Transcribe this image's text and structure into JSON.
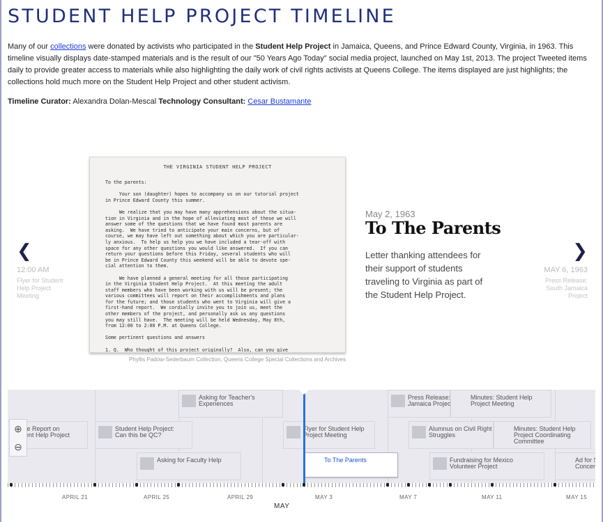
{
  "page": {
    "title": "STUDENT HELP PROJECT TIMELINE",
    "intro": {
      "p1": "Many of our ",
      "link": "collections",
      "p2": " were donated by activists who participated in the ",
      "bold": "Student Help Project",
      "p3": " in Jamaica, Queens, and Prince Edward County, Virginia, in 1963. This timeline visually displays date-stamped materials and is the result of our \"50 Years Ago Today\" social media project, launched on May 1st, 2013. The project Tweeted items daily to provide greater access to materials while also highlighting the daily work of civil rights activists at Queens College. The items displayed are just highlights; the collections hold much more on the Student Help Project and other student activism."
    },
    "credits": {
      "curator_label": "Timeline Curator:",
      "curator": "Alexandra Dolan-Mescal",
      "consultant_label": "Technology Consultant:",
      "consultant": "Cesar Bustamante"
    }
  },
  "slide": {
    "date": "May 2, 1963",
    "title": "To The Parents",
    "text": "Letter thanking attendees for their support of students traveling to Virginia as part of the Student Help Project.",
    "caption": "Phyllis Padow-Sederbaum Collection, Queens College Special Collections and Archives",
    "document": {
      "title": "THE VIRGINIA STUDENT HELP PROJECT",
      "body": "To the parents:\n\n     Your son (daughter) hopes to accompany us on our tutorial project\nin Prince Edward County this summer.\n\n     We realize that you may have many apprehensions about the situa-\ntion in Virginia and in the hope of alleviating most of these we will\nanswer some of the questions that we have found most parents are\nasking.  We have tried to anticipate your main concerns, but of\ncourse, we may have left out something about which you are particular-\nly anxious.  To help us help you we have included a tear-off with\nspace for any other questions you would like answered.  If you can\nreturn your questions before this Friday, several students who will\nbe in Prince Edward County this weekend will be able to devote spe-\ncial attention to them.\n\n     We have planned a general meeting for all those participating\nin the Virginia Student Help Project.  At this meeting the adult\nstaff members who have been working with us will be present; the\nvarious committees will report on their accomplishments and plans\nfor the future; and those students who went to Virginia will give a\nfirst-hand report.  We cordially invite you to join us, meet the\nother members of the project, and personally ask us any questions\nyou may still have.  The meeting will be held Wednesday, May 8th,\nfrom 12:00 to 2:00 P.M. at Queens College.\n\nSome pertinent questions and answers\n\n1. Q.  Who thought of this project originally?  Also, can you give\n   us some background material on the situation in Prince Edward\n   County - why are you doing this?"
    }
  },
  "nav": {
    "prev": {
      "time": "12:00 AM",
      "desc": "Flyer for Student Help Project Meeting"
    },
    "next": {
      "time": "MAY 6, 1963",
      "desc": "Press Release: South Jamaica Project"
    }
  },
  "timeline": {
    "events": [
      {
        "label": "Asking for Teacher's\nExperiences",
        "active": false
      },
      {
        "label": "nate Report on\nudent Help Project",
        "active": false
      },
      {
        "label": "Student Help Project:\nCan this be QC?",
        "active": false
      },
      {
        "label": "Asking for Faculty Help",
        "active": false
      },
      {
        "label": "Flyer for Student Help\nProject Meeting",
        "active": false
      },
      {
        "label": "To The Parents",
        "active": true
      },
      {
        "label": "Press Release:\nJamaica Projec",
        "active": false
      },
      {
        "label": "Minutes: Student Help\nProject Meeting",
        "active": false
      },
      {
        "label": "Alumnus on Civil Right\nStruggles",
        "active": false
      },
      {
        "label": "Minutes: Student Help\nProject Coordinating\nCommittee",
        "active": false
      },
      {
        "label": "Fundraising for Mexico\nVolunteer Project",
        "active": false
      },
      {
        "label": "Ad for S\nConcer",
        "active": false
      }
    ],
    "zoom_in": "⊕",
    "zoom_out": "⊖",
    "axis_labels": [
      "APRIL 21",
      "APRIL 25",
      "APRIL 29",
      "MAY 3",
      "MAY 7",
      "MAY 11",
      "MAY 15"
    ],
    "month": "MAY"
  },
  "icons": {
    "prev": "chevron-left-icon",
    "next": "chevron-right-icon",
    "zoom_in": "zoom-in-icon",
    "zoom_out": "zoom-out-icon"
  },
  "colors": {
    "title": "#1e2f7a",
    "marker": "#2a72d6",
    "link": "#1d3ad6"
  }
}
